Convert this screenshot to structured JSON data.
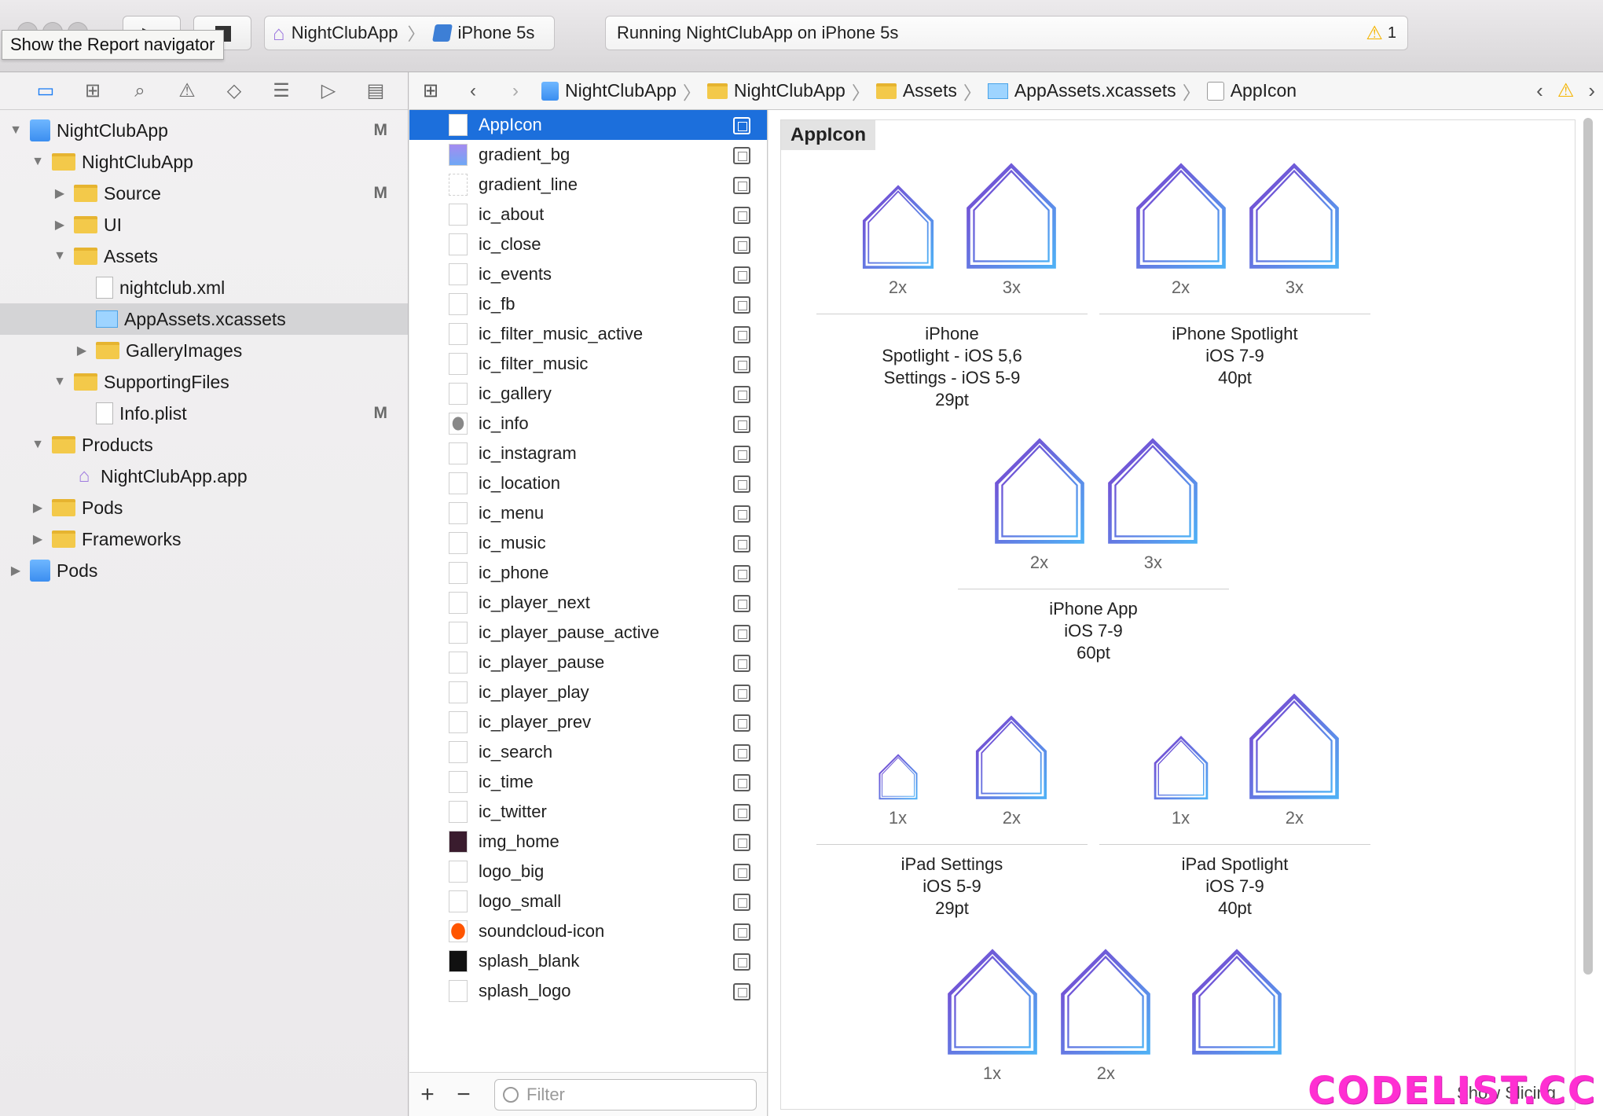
{
  "toolbar": {
    "tooltip": "Show the Report navigator",
    "scheme": {
      "target": "NightClubApp",
      "device": "iPhone 5s"
    },
    "activity": {
      "status": "Running NightClubApp on iPhone 5s",
      "warning_count": "1"
    }
  },
  "navigator": {
    "tabs": [
      "folder-icon",
      "hierarchy-icon",
      "search-icon",
      "warning-icon",
      "test-icon",
      "debug-icon",
      "breakpoint-icon",
      "report-icon"
    ],
    "tree": [
      {
        "label": "NightClubApp",
        "depth": 0,
        "type": "project",
        "open": true,
        "badge": "M"
      },
      {
        "label": "NightClubApp",
        "depth": 1,
        "type": "folder",
        "open": true,
        "badge": ""
      },
      {
        "label": "Source",
        "depth": 2,
        "type": "folder",
        "open": false,
        "badge": "M"
      },
      {
        "label": "UI",
        "depth": 2,
        "type": "folder",
        "open": false,
        "badge": ""
      },
      {
        "label": "Assets",
        "depth": 2,
        "type": "folder",
        "open": true,
        "badge": ""
      },
      {
        "label": "nightclub.xml",
        "depth": 3,
        "type": "file",
        "badge": ""
      },
      {
        "label": "AppAssets.xcassets",
        "depth": 3,
        "type": "xcassets",
        "selected": true,
        "badge": ""
      },
      {
        "label": "GalleryImages",
        "depth": 3,
        "type": "folder",
        "open": false,
        "badge": ""
      },
      {
        "label": "SupportingFiles",
        "depth": 2,
        "type": "folder",
        "open": true,
        "badge": ""
      },
      {
        "label": "Info.plist",
        "depth": 3,
        "type": "file",
        "badge": "M"
      },
      {
        "label": "Products",
        "depth": 1,
        "type": "folder",
        "open": true,
        "badge": ""
      },
      {
        "label": "NightClubApp.app",
        "depth": 2,
        "type": "app",
        "badge": ""
      },
      {
        "label": "Pods",
        "depth": 1,
        "type": "folder",
        "open": false,
        "badge": ""
      },
      {
        "label": "Frameworks",
        "depth": 1,
        "type": "folder",
        "open": false,
        "badge": ""
      },
      {
        "label": "Pods",
        "depth": 0,
        "type": "project",
        "open": false,
        "badge": ""
      }
    ]
  },
  "jumpbar": {
    "crumbs": [
      {
        "label": "NightClubApp",
        "icon": "project-icon"
      },
      {
        "label": "NightClubApp",
        "icon": "folder-icon"
      },
      {
        "label": "Assets",
        "icon": "folder-icon"
      },
      {
        "label": "AppAssets.xcassets",
        "icon": "asset-catalog-icon"
      },
      {
        "label": "AppIcon",
        "icon": "appicon-icon"
      }
    ]
  },
  "assets": {
    "items": [
      "AppIcon",
      "gradient_bg",
      "gradient_line",
      "ic_about",
      "ic_close",
      "ic_events",
      "ic_fb",
      "ic_filter_music_active",
      "ic_filter_music",
      "ic_gallery",
      "ic_info",
      "ic_instagram",
      "ic_location",
      "ic_menu",
      "ic_music",
      "ic_phone",
      "ic_player_next",
      "ic_player_pause_active",
      "ic_player_pause",
      "ic_player_play",
      "ic_player_prev",
      "ic_search",
      "ic_time",
      "ic_twitter",
      "img_home",
      "logo_big",
      "logo_small",
      "soundcloud-icon",
      "splash_blank",
      "splash_logo"
    ],
    "selected": "AppIcon",
    "filter_placeholder": "Filter",
    "add_label": "+",
    "remove_label": "−"
  },
  "detail": {
    "set_name": "AppIcon",
    "groups": [
      {
        "scales": [
          "2x",
          "3x"
        ],
        "lines": [
          "iPhone",
          "Spotlight - iOS 5,6",
          "Settings - iOS 5-9",
          "29pt"
        ]
      },
      {
        "scales": [
          "2x",
          "3x"
        ],
        "lines": [
          "iPhone Spotlight",
          "iOS 7-9",
          "40pt"
        ]
      },
      {
        "scales": [
          "2x",
          "3x"
        ],
        "lines": [
          "iPhone App",
          "iOS 7-9",
          "60pt"
        ]
      },
      {
        "scales": [
          "1x",
          "2x"
        ],
        "lines": [
          "iPad Settings",
          "iOS 5-9",
          "29pt"
        ]
      },
      {
        "scales": [
          "1x",
          "2x"
        ],
        "lines": [
          "iPad Spotlight",
          "iOS 7-9",
          "40pt"
        ]
      },
      {
        "scales": [
          "1x",
          "2x"
        ],
        "lines": []
      },
      {
        "scales": [],
        "lines": []
      }
    ],
    "show_slicing": "Show Slicing"
  },
  "watermark": "CODELIST.CC",
  "colors": {
    "selection": "#1c6fdc",
    "accent": "#1a7cf4",
    "warning": "#f4b400",
    "icon_gradient": [
      "#7a3fcf",
      "#4fb0f5"
    ]
  }
}
